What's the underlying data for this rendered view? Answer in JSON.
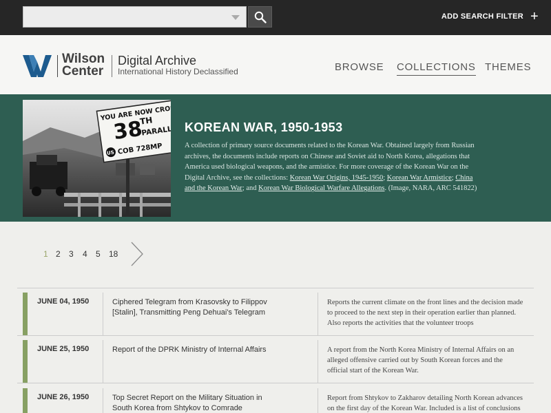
{
  "topbar": {
    "search_placeholder": "",
    "add_filter_label": "ADD SEARCH FILTER",
    "add_filter_icon": "plus-icon"
  },
  "header": {
    "logo_name_line1": "Wilson",
    "logo_name_line2": "Center",
    "site_title": "Digital Archive",
    "site_subtitle": "International History Declassified",
    "nav": [
      {
        "label": "BROWSE",
        "active": false
      },
      {
        "label": "COLLECTIONS",
        "active": true
      },
      {
        "label": "THEMES",
        "active": false
      }
    ],
    "logo_color": "#1d5b8e"
  },
  "hero": {
    "title": "KOREAN WAR, 1950-1953",
    "desc_intro": "A collection of primary source documents related to the Korean War. Obtained largely from Russian archives, the documents include reports on Chinese and Soviet aid to North Korea, allegations that America used biological weapons, and the armistice. For more coverage of the Korean War on the Digital Archive, see the collections: ",
    "links": [
      "Korean War Origins, 1945-1950",
      "Korean War Armistice",
      "China and the Korean War",
      "Korean War Biological Warfare Allegations"
    ],
    "sep1": "; ",
    "sep2": "; ",
    "sep3": "; and ",
    "desc_outro": ". (Image, NARA, ARC 541822)",
    "sign": {
      "line1": "YOU ARE NOW CROSSING",
      "line2": "38",
      "line2b": "TH",
      "line3": "PARALLEL",
      "line4": "COB 728MP",
      "badge": "US"
    },
    "bg_color": "#2e5e52"
  },
  "pagination": {
    "pages": [
      "1",
      "2",
      "3",
      "4",
      "5",
      "18"
    ],
    "current": "1",
    "next_icon": "chevron-right-icon"
  },
  "documents": [
    {
      "date": "JUNE 04, 1950",
      "title": "Ciphered Telegram from Krasovsky to Filippov [Stalin], Transmitting Peng Dehuai's Telegram",
      "summary": "Reports the current climate on the front lines and the decision made to proceed to the next step in their operation earlier than planned. Also reports the activities that the volunteer troops"
    },
    {
      "date": "JUNE 25, 1950",
      "title": "Report of the DPRK Ministry of Internal Affairs",
      "summary": "A report from the North Korea Ministry of Internal Affairs on an alleged offensive carried out by South Korean forces and the official start of the Korean War."
    },
    {
      "date": "JUNE 26, 1950",
      "title": "Top Secret Report on the Military Situation in South Korea from Shtykov to Comrade",
      "summary": "Report from Shtykov to Zakharov detailing North Korean advances on the first day of the Korean War. Included is a list of conclusions"
    }
  ],
  "accent_color": "#87a063"
}
